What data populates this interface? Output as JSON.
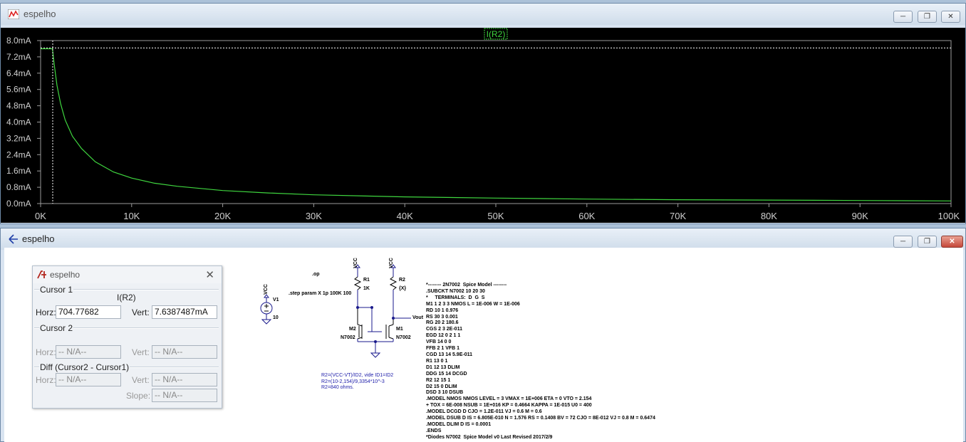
{
  "plot_window": {
    "title": "espelho",
    "trace_label": "I(R2)",
    "colors": {
      "trace": "#3fd63f",
      "background": "#000000",
      "axes": "#9a9a9a",
      "title_box": "#3fd63f"
    }
  },
  "chart_data": {
    "type": "line",
    "title": "I(R2)",
    "xlabel": "",
    "ylabel": "",
    "x_ticks": [
      "0K",
      "10K",
      "20K",
      "30K",
      "40K",
      "50K",
      "60K",
      "70K",
      "80K",
      "90K",
      "100K"
    ],
    "y_ticks": [
      "8.0mA",
      "7.2mA",
      "6.4mA",
      "5.6mA",
      "4.8mA",
      "4.0mA",
      "3.2mA",
      "2.4mA",
      "1.6mA",
      "0.8mA",
      "0.0mA"
    ],
    "xlim": [
      0,
      100000
    ],
    "ylim": [
      0,
      8.0
    ],
    "series": [
      {
        "name": "I(R2)",
        "x": [
          0,
          800,
          1300,
          1500,
          1800,
          2200,
          2700,
          3500,
          4500,
          6000,
          8000,
          10000,
          12500,
          15000,
          20000,
          25000,
          30000,
          40000,
          50000,
          60000,
          70000,
          80000,
          90000,
          100000
        ],
        "y": [
          7.6,
          7.6,
          7.6,
          6.8,
          5.8,
          4.9,
          4.1,
          3.3,
          2.7,
          2.05,
          1.55,
          1.25,
          1.0,
          0.85,
          0.64,
          0.52,
          0.43,
          0.33,
          0.27,
          0.22,
          0.19,
          0.17,
          0.15,
          0.13
        ]
      }
    ],
    "cursor": {
      "x": 704.77682,
      "y": 7.6387487
    },
    "grid": false
  },
  "schematic_window": {
    "title": "espelho"
  },
  "cursor_dialog": {
    "title": "espelho",
    "cursor1_label": "Cursor 1",
    "trace": "I(R2)",
    "horz_label": "Horz:",
    "vert_label": "Vert:",
    "horz_value": "704.77682",
    "vert_value": "7.6387487mA",
    "cursor2_label": "Cursor 2",
    "c2_horz": "-- N/A--",
    "c2_vert": "-- N/A--",
    "diff_label": "Diff (Cursor2 - Cursor1)",
    "diff_horz": "-- N/A--",
    "diff_vert": "-- N/A--",
    "slope_label": "Slope:",
    "slope_value": "-- N/A--"
  },
  "schematic": {
    "op": ".op",
    "step": ".step param X 1p 100K 100",
    "vcc1": "VCC",
    "v1": "V1",
    "v1_val": "10",
    "vcc_r1": "VCC",
    "vcc_r2": "VCC",
    "r1": "R1",
    "r1_val": "1K",
    "r2": "R2",
    "r2_val": "{X}",
    "vout": "Vout",
    "m2": "M2",
    "m2_model": "N7002",
    "m1": "M1",
    "m1_model": "N7002",
    "comment_lines": "R2=(VCC-VT)/ID2, vide ID1=ID2\nR2=(10-2,154)/9,3354*10^-3\nR2=840 ohms.",
    "spice_model": "*-------- 2N7002  Spice Model --------\n.SUBCKT N7002 10 20 30\n*     TERMINALS:  D  G  S\nM1 1 2 3 3 NMOS L = 1E-006 W = 1E-006\nRD 10 1 0.976\nRS 30 3 0.001\nRG 20 2 180.6\nCGS 2 3 2E-011\nEGD 12 0 2 1 1\nVFB 14 0 0\nFFB 2 1 VFB 1\nCGD 13 14 5.9E-011\nR1 13 0 1\nD1 12 13 DLIM\nDDG 15 14 DCGD\nR2 12 15 1\nD2 15 0 DLIM\nDSD 3 10 DSUB\n.MODEL NMOS NMOS LEVEL = 3 VMAX = 1E+006 ETA = 0 VTO = 2.154\n+ TOX = 6E-008 NSUB = 1E+016 KP = 0.4664 KAPPA = 1E-015 U0 = 400\n.MODEL DCGD D CJO = 1.2E-011 VJ = 0.6 M = 0.6\n.MODEL DSUB D IS = 6.805E-010 N = 1.576 RS = 0.1408 BV = 72 CJO = 8E-012 VJ = 0.8 M = 0.6474\n.MODEL DLIM D IS = 0.0001\n.ENDS\n*Diodes N7002  Spice Model v0 Last Revised 2017/2/9"
  }
}
